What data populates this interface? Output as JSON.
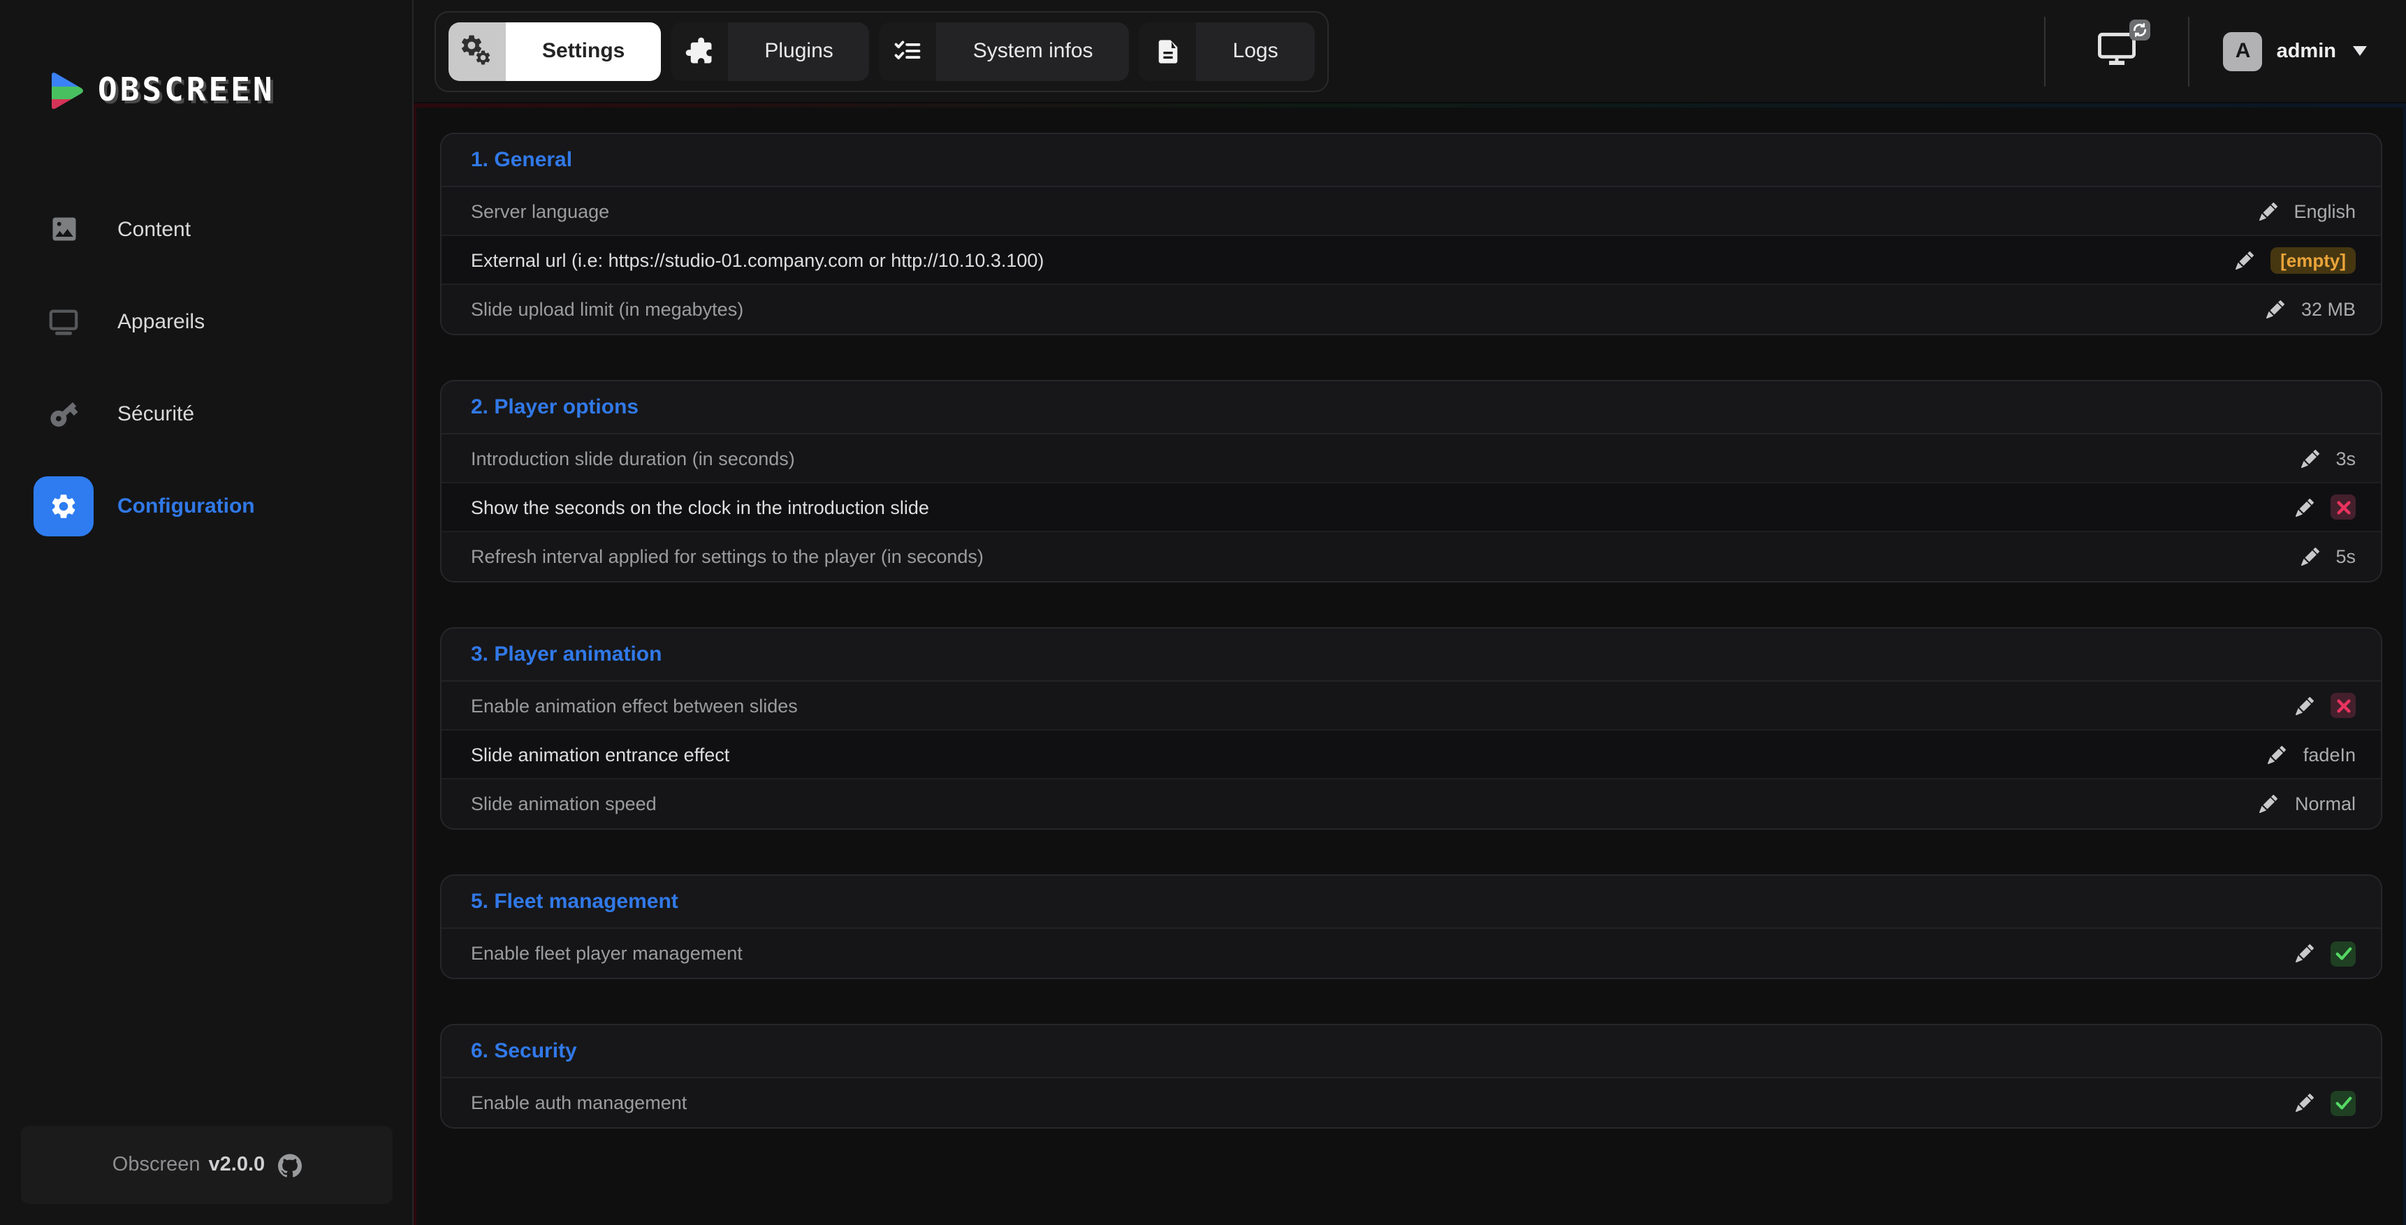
{
  "brand": {
    "name": "OBSCREEN"
  },
  "sidebar": {
    "items": [
      {
        "label": "Content",
        "icon": "image-icon",
        "active": false
      },
      {
        "label": "Appareils",
        "icon": "monitor-icon",
        "active": false
      },
      {
        "label": "Sécurité",
        "icon": "key-icon",
        "active": false
      },
      {
        "label": "Configuration",
        "icon": "gear-icon",
        "active": true
      }
    ],
    "footer": {
      "app": "Obscreen",
      "version": "v2.0.0",
      "icon": "github-icon"
    }
  },
  "topbar": {
    "tabs": [
      {
        "label": "Settings",
        "icon": "gears-icon",
        "active": true
      },
      {
        "label": "Plugins",
        "icon": "puzzle-icon",
        "active": false
      },
      {
        "label": "System infos",
        "icon": "checklist-icon",
        "active": false
      },
      {
        "label": "Logs",
        "icon": "document-icon",
        "active": false
      }
    ],
    "screen_button_icon": "monitor-refresh-icon",
    "user": {
      "initial": "A",
      "name": "admin"
    }
  },
  "sections": [
    {
      "title": "1. General",
      "rows": [
        {
          "label": "Server language",
          "bright": false,
          "value_type": "text",
          "value": "English"
        },
        {
          "label": "External url (i.e: https://studio-01.company.com or http://10.10.3.100)",
          "bright": true,
          "value_type": "empty",
          "value": "[empty]"
        },
        {
          "label": "Slide upload limit (in megabytes)",
          "bright": false,
          "value_type": "text",
          "value": "32 MB"
        }
      ]
    },
    {
      "title": "2. Player options",
      "rows": [
        {
          "label": "Introduction slide duration (in seconds)",
          "bright": false,
          "value_type": "text",
          "value": "3s"
        },
        {
          "label": "Show the seconds on the clock in the introduction slide",
          "bright": true,
          "value_type": "cross",
          "value": ""
        },
        {
          "label": "Refresh interval applied for settings to the player (in seconds)",
          "bright": false,
          "value_type": "text",
          "value": "5s"
        }
      ]
    },
    {
      "title": "3. Player animation",
      "rows": [
        {
          "label": "Enable animation effect between slides",
          "bright": false,
          "value_type": "cross",
          "value": ""
        },
        {
          "label": "Slide animation entrance effect",
          "bright": true,
          "value_type": "text",
          "value": "fadeIn"
        },
        {
          "label": "Slide animation speed",
          "bright": false,
          "value_type": "text",
          "value": "Normal"
        }
      ]
    },
    {
      "title": "5. Fleet management",
      "rows": [
        {
          "label": "Enable fleet player management",
          "bright": false,
          "value_type": "check",
          "value": ""
        }
      ]
    },
    {
      "title": "6. Security",
      "rows": [
        {
          "label": "Enable auth management",
          "bright": false,
          "value_type": "check",
          "value": ""
        }
      ]
    }
  ],
  "colors": {
    "accent": "#3179e8",
    "sidebar-active": "#2e7cf0",
    "warn-text": "#eaa43a",
    "warn-bg": "#463711",
    "danger-text": "#ea3360",
    "danger-bg": "#44202c",
    "success-text": "#54d964",
    "success-bg": "#1f4023",
    "edge-red": "#2b090d",
    "edge-navy": "#0c1626"
  }
}
